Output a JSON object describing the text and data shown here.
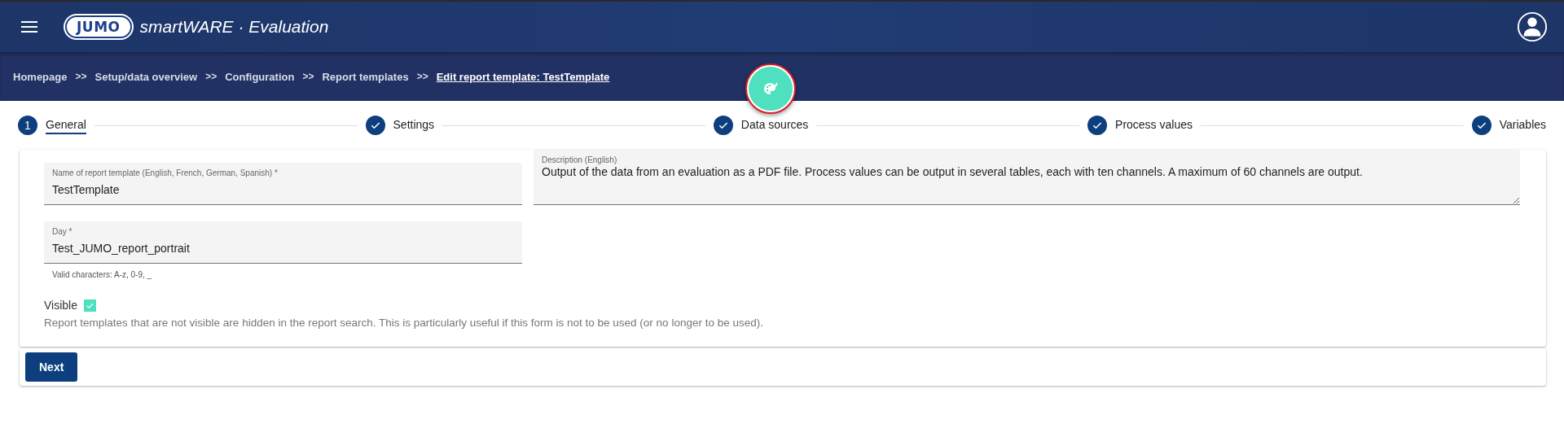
{
  "header": {
    "logo": "JUMO",
    "app_title": "smartWARE · Evaluation"
  },
  "breadcrumbs": [
    {
      "label": "Homepage",
      "current": false
    },
    {
      "label": "Setup/data overview",
      "current": false
    },
    {
      "label": "Configuration",
      "current": false
    },
    {
      "label": "Report templates",
      "current": false
    },
    {
      "label": "Edit report template: TestTemplate",
      "current": true
    }
  ],
  "breadcrumb_separator": ">>",
  "steps": [
    {
      "number": "1",
      "label": "General",
      "completed": false,
      "selected": true
    },
    {
      "label": "Settings",
      "completed": true,
      "selected": false
    },
    {
      "label": "Data sources",
      "completed": true,
      "selected": false
    },
    {
      "label": "Process values",
      "completed": true,
      "selected": false
    },
    {
      "label": "Variables",
      "completed": true,
      "selected": false
    }
  ],
  "form": {
    "name_field": {
      "label": "Name of report template (English, French, German, Spanish) *",
      "value": "TestTemplate"
    },
    "description_field": {
      "label": "Description (English)",
      "value": "Output of the data from an evaluation as a PDF file. Process values can be output in several tables, each with ten channels. A maximum of 60 channels are output."
    },
    "day_field": {
      "label": "Day *",
      "value": "Test_JUMO_report_portrait",
      "hint": "Valid characters: A-z, 0-9, _"
    },
    "visible": {
      "label": "Visible",
      "checked": true,
      "help": "Report templates that are not visible are hidden in the report search. This is particularly useful if this form is not to be used (or no longer to be used)."
    }
  },
  "buttons": [
    {
      "label": "Next"
    }
  ]
}
